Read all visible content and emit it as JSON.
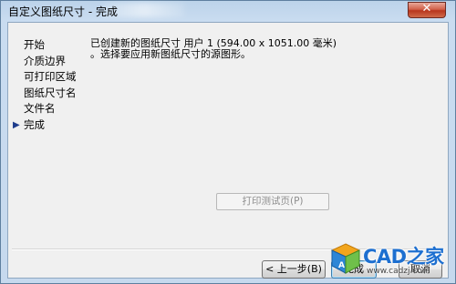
{
  "window": {
    "title": "自定义图纸尺寸 - 完成",
    "close_glyph": "✕"
  },
  "nav": {
    "items": [
      {
        "label": "开始",
        "current": false
      },
      {
        "label": "介质边界",
        "current": false
      },
      {
        "label": "可打印区域",
        "current": false
      },
      {
        "label": "图纸尺寸名",
        "current": false
      },
      {
        "label": "文件名",
        "current": false
      },
      {
        "label": "完成",
        "current": true
      }
    ],
    "current_marker": "▶"
  },
  "message": {
    "line1": "已创建新的图纸尺寸 用户 1 (594.00 x 1051.00 毫米)",
    "line2": "。选择要应用新图纸尺寸的源图形。"
  },
  "buttons": {
    "test_print": "打印测试页(P)",
    "back": "< 上一步(B)",
    "finish": "完成",
    "cancel": "取消"
  },
  "watermark": {
    "brand": "CAD之家",
    "url": "www.cadzj.com"
  },
  "colors": {
    "accent": "#1d6fd0",
    "close_red": "#c8432a"
  }
}
